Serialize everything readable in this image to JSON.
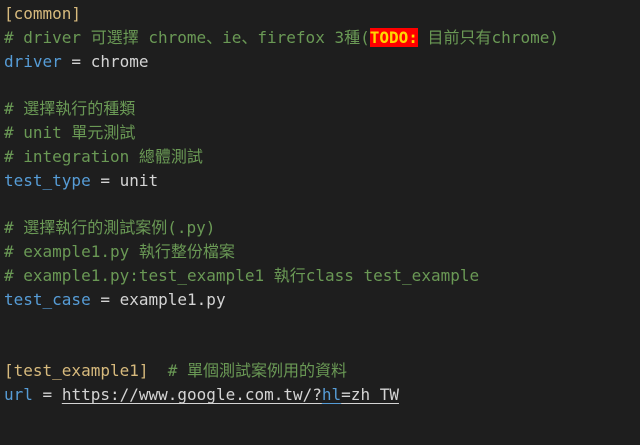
{
  "colors": {
    "background": "#1e1e1e",
    "section": "#d7ba7d",
    "comment": "#6a9955",
    "key": "#569cd6",
    "text": "#d4d4d4",
    "todo_bg": "#ff0000",
    "todo_fg": "#ffd700"
  },
  "lines": {
    "common_section": "[common]",
    "driver_comment_pre": "# driver 可選擇 chrome、ie、firefox 3種(",
    "driver_comment_todo": "TODO:",
    "driver_comment_post": " 目前只有chrome)",
    "driver_key": "driver",
    "driver_eq": " = ",
    "driver_value": "chrome",
    "type_comment_1": "# 選擇執行的種類",
    "type_comment_2": "# unit 單元測試",
    "type_comment_3": "# integration 總體測試",
    "type_key": "test_type",
    "type_eq": " = ",
    "type_value": "unit",
    "case_comment_1": "# 選擇執行的測試案例(.py)",
    "case_comment_2": "# example1.py 執行整份檔案",
    "case_comment_3": "# example1.py:test_example1 執行class test_example",
    "case_key": "test_case",
    "case_eq": " = ",
    "case_value": "example1.py",
    "example_section": "[test_example1]",
    "example_comment": "  # 單個測試案例用的資料",
    "url_key": "url",
    "url_eq": " = ",
    "url_value_pre": "https://www.google.com.tw/?",
    "url_value_param": "hl",
    "url_value_post": "=zh_TW"
  }
}
